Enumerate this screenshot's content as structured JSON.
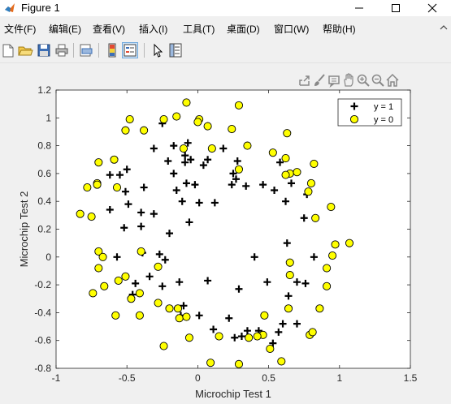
{
  "window": {
    "title": "Figure 1"
  },
  "menu": {
    "items": [
      "文件(F)",
      "编辑(E)",
      "查看(V)",
      "插入(I)",
      "工具(T)",
      "桌面(D)",
      "窗口(W)",
      "帮助(H)"
    ]
  },
  "toolbar": {
    "buttons": [
      "new-figure",
      "open-file",
      "save",
      "print",
      "print-preview",
      "toggle-colorbar",
      "insert-legend",
      "edit-plot",
      "property-inspector"
    ]
  },
  "axes_toolbar": {
    "icons": [
      "export-icon",
      "brush-icon",
      "data-tips-icon",
      "pan-icon",
      "zoom-in-icon",
      "zoom-out-icon",
      "home-icon"
    ]
  },
  "chart_data": {
    "type": "scatter",
    "xlabel": "Microchip Test 1",
    "ylabel": "Microchip Test 2",
    "xlim": [
      -1,
      1.5
    ],
    "ylim": [
      -0.8,
      1.2
    ],
    "xticks": [
      "-1",
      "-0.5",
      "0",
      "0.5",
      "1",
      "1.5"
    ],
    "yticks": [
      "-0.8",
      "-0.6",
      "-0.4",
      "-0.2",
      "0",
      "0.2",
      "0.4",
      "0.6",
      "0.8",
      "1",
      "1.2"
    ],
    "grid": false,
    "legend_position": "top-right",
    "series": [
      {
        "name": "y = 1",
        "marker": "plus",
        "color": "#000000",
        "points": [
          [
            -0.05,
            0.7
          ],
          [
            -0.09,
            0.68
          ],
          [
            -0.21,
            0.69
          ],
          [
            -0.38,
            0.5
          ],
          [
            -0.51,
            0.47
          ],
          [
            -0.52,
            0.21
          ],
          [
            -0.4,
            0.22
          ],
          [
            -0.31,
            0.31
          ],
          [
            -0.2,
            0.17
          ],
          [
            -0.11,
            0.4
          ],
          [
            -0.09,
            0.73
          ],
          [
            -0.02,
            0.52
          ],
          [
            0.07,
            0.7
          ],
          [
            0.27,
            0.56
          ],
          [
            0.28,
            0.69
          ],
          [
            0.46,
            0.52
          ],
          [
            0.66,
            0.53
          ],
          [
            0.75,
            0.28
          ],
          [
            0.82,
            0.0
          ],
          [
            0.64,
            -0.28
          ],
          [
            0.7,
            -0.48
          ],
          [
            0.6,
            -0.48
          ],
          [
            0.43,
            -0.53
          ],
          [
            0.35,
            -0.53
          ],
          [
            0.22,
            -0.44
          ],
          [
            0.11,
            -0.52
          ],
          [
            0.01,
            -0.42
          ],
          [
            -0.12,
            -0.42
          ],
          [
            -0.25,
            -0.21
          ],
          [
            -0.44,
            -0.19
          ],
          [
            -0.46,
            -0.27
          ],
          [
            -0.57,
            0.0
          ],
          [
            -0.62,
            0.34
          ],
          [
            -0.62,
            0.59
          ],
          [
            -0.5,
            0.63
          ],
          [
            -0.31,
            0.78
          ],
          [
            -0.25,
            0.96
          ],
          [
            -0.17,
            0.8
          ],
          [
            -0.07,
            0.82
          ],
          [
            0.18,
            0.78
          ],
          [
            0.34,
            0.51
          ],
          [
            0.54,
            0.48
          ],
          [
            0.77,
            0.45
          ],
          [
            0.4,
            0.0
          ],
          [
            0.29,
            -0.23
          ],
          [
            0.07,
            -0.17
          ],
          [
            -0.13,
            -0.18
          ],
          [
            -0.23,
            -0.02
          ],
          [
            -0.34,
            -0.14
          ],
          [
            -0.39,
            0.03
          ],
          [
            -0.17,
            0.6
          ],
          [
            0.12,
            0.39
          ],
          [
            -0.49,
            0.38
          ],
          [
            0.04,
            0.66
          ],
          [
            -0.55,
            0.59
          ],
          [
            0.24,
            0.52
          ],
          [
            0.49,
            -0.18
          ],
          [
            0.63,
            0.1
          ],
          [
            0.7,
            -0.18
          ],
          [
            0.76,
            -0.19
          ],
          [
            -0.08,
            0.53
          ],
          [
            -0.15,
            0.48
          ],
          [
            -0.06,
            0.25
          ],
          [
            0.25,
            0.6
          ],
          [
            -0.1,
            -0.35
          ],
          [
            -0.27,
            0.02
          ],
          [
            0.57,
            -0.54
          ],
          [
            0.26,
            -0.58
          ],
          [
            0.53,
            -0.62
          ],
          [
            0.31,
            -0.57
          ],
          [
            0.01,
            0.39
          ],
          [
            0.58,
            0.68
          ],
          [
            -0.4,
            0.32
          ],
          [
            0.62,
            0.4
          ]
        ]
      },
      {
        "name": "y = 0",
        "marker": "circle",
        "color": "#ffff00",
        "points": [
          [
            -0.08,
            1.11
          ],
          [
            0.29,
            1.09
          ],
          [
            -0.48,
            0.99
          ],
          [
            -0.38,
            0.91
          ],
          [
            -0.51,
            0.91
          ],
          [
            -0.7,
            0.68
          ],
          [
            -0.71,
            0.53
          ],
          [
            -0.78,
            0.5
          ],
          [
            -0.83,
            0.31
          ],
          [
            -0.75,
            0.29
          ],
          [
            -0.7,
            0.04
          ],
          [
            -0.7,
            -0.08
          ],
          [
            -0.66,
            -0.21
          ],
          [
            -0.74,
            -0.26
          ],
          [
            -0.58,
            -0.42
          ],
          [
            -0.47,
            -0.3
          ],
          [
            -0.41,
            -0.42
          ],
          [
            -0.28,
            -0.07
          ],
          [
            -0.2,
            -0.37
          ],
          [
            -0.13,
            -0.44
          ],
          [
            -0.06,
            -0.58
          ],
          [
            -0.24,
            -0.64
          ],
          [
            0.09,
            -0.76
          ],
          [
            0.15,
            -0.57
          ],
          [
            0.29,
            -0.77
          ],
          [
            0.36,
            -0.58
          ],
          [
            0.46,
            -0.56
          ],
          [
            0.51,
            -0.66
          ],
          [
            0.59,
            -0.75
          ],
          [
            0.79,
            -0.56
          ],
          [
            0.81,
            -0.54
          ],
          [
            0.86,
            -0.37
          ],
          [
            0.91,
            -0.21
          ],
          [
            0.91,
            -0.08
          ],
          [
            0.95,
            0.01
          ],
          [
            0.97,
            0.09
          ],
          [
            1.07,
            0.1
          ],
          [
            0.94,
            0.36
          ],
          [
            0.83,
            0.28
          ],
          [
            0.78,
            0.47
          ],
          [
            0.8,
            0.53
          ],
          [
            0.82,
            0.67
          ],
          [
            0.65,
            0.6
          ],
          [
            0.62,
            0.71
          ],
          [
            0.63,
            0.89
          ],
          [
            0.35,
            0.8
          ],
          [
            0.24,
            0.92
          ],
          [
            0.07,
            0.94
          ],
          [
            0.01,
            0.99
          ],
          [
            -0.15,
            1.01
          ],
          [
            -0.24,
            0.99
          ],
          [
            -0.1,
            0.78
          ],
          [
            0.1,
            0.78
          ],
          [
            0.29,
            0.63
          ],
          [
            0.53,
            0.75
          ],
          [
            -0.59,
            0.7
          ],
          [
            -0.57,
            0.5
          ],
          [
            -0.67,
            0.0
          ],
          [
            -0.4,
            0.04
          ],
          [
            -0.51,
            -0.14
          ],
          [
            -0.28,
            -0.33
          ],
          [
            -0.41,
            -0.26
          ],
          [
            -0.14,
            -0.37
          ],
          [
            -0.08,
            -0.43
          ],
          [
            0.42,
            -0.57
          ],
          [
            0.64,
            -0.37
          ],
          [
            0.47,
            -0.42
          ],
          [
            0.65,
            -0.04
          ],
          [
            0.65,
            -0.13
          ],
          [
            0.62,
            0.59
          ],
          [
            0.7,
            0.61
          ],
          [
            -0.56,
            -0.17
          ],
          [
            -0.71,
            0.52
          ],
          [
            0.0,
            0.97
          ]
        ]
      }
    ]
  }
}
